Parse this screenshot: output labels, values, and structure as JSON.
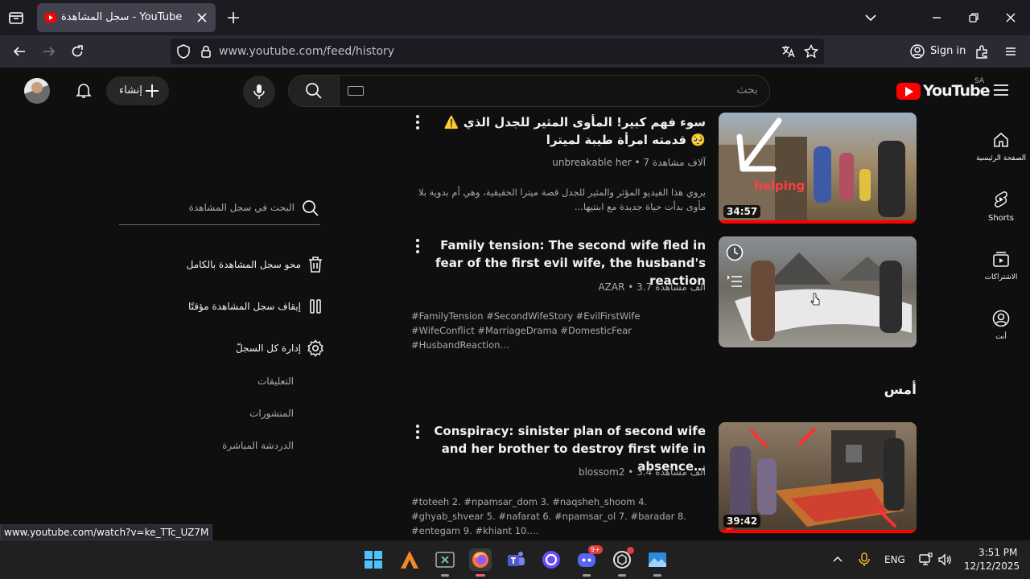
{
  "browser": {
    "tab_title": "سجل المشاهدة - YouTube",
    "url_domain": "www.youtube.com",
    "url_path": "/feed/history",
    "sign_in": "Sign in"
  },
  "header": {
    "create_label": "إنشاء",
    "search_placeholder": "بحث",
    "logo_text": "YouTube",
    "country_code": "SA"
  },
  "guide": [
    {
      "label": "الصفحة الرئيسية",
      "icon": "home-icon"
    },
    {
      "label": "Shorts",
      "icon": "shorts-icon"
    },
    {
      "label": "الاشتراكات",
      "icon": "subscriptions-icon"
    },
    {
      "label": "أنت",
      "icon": "you-icon"
    }
  ],
  "side_panel": {
    "search_placeholder": "البحث في سجل المشاهدة",
    "clear_all": "محو سجل المشاهدة بالكامل",
    "pause": "إيقاف سجل المشاهدة مؤقتًا",
    "manage_all": "إدارة كل السجلّ",
    "comments": "التعليقات",
    "posts": "المنشورات",
    "live_chat": "الدردشة المباشرة"
  },
  "section_yesterday": "أمس",
  "videos": [
    {
      "title": "⚠️ سوء فهم كبير! المأوى المثير للجدل الذي قدمته امرأة طيبة لميترا 🥺",
      "meta": "unbreakable her • 7 آلاف مشاهدة",
      "desc": "يروي هذا الفيديو المؤثر والمثير للجدل قصة ميترا الحقيقية، وهي أم بدوية بلا مأوى بدأت حياة جديدة مع ابنتيها...",
      "duration": "34:57",
      "overlay": "helping",
      "watched": 1.0
    },
    {
      "title": "Family tension: The second wife fled in fear of the first evil wife, the husband's reaction",
      "meta": "AZAR • 3.7 ألف مشاهدة",
      "desc": "#FamilyTension #SecondWifeStory #EvilFirstWife #WifeConflict #MarriageDrama #DomesticFear #HusbandReaction…",
      "duration": "",
      "watched": 0
    },
    {
      "title": "Conspiracy: sinister plan of second wife and her brother to destroy first wife in  absence…",
      "meta": "blossom2 • 3.4 ألف مشاهدة",
      "desc": "#toteeh 2. #npamsar_dom 3. #naqsheh_shoom 4. #ghyab_shvear 5. #nafarat 6. #npamsar_ol 7. #baradar 8. #entegam 9. #khiant 10.…",
      "duration": "39:42",
      "watched": 1.0
    }
  ],
  "status_bar_url": "www.youtube.com/watch?v=ke_TTc_UZ7M",
  "taskbar": {
    "lang": "ENG",
    "time": "3:51 PM",
    "date": "12/12/2025",
    "discord_badge": "9+"
  },
  "colors": {
    "accent": "#ff0000",
    "bg": "#0f0f0f"
  }
}
